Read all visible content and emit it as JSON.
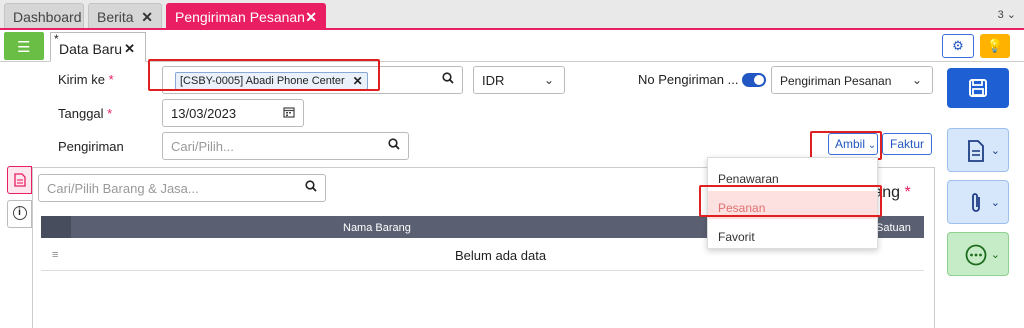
{
  "top_tabs": [
    {
      "label": "Dashboard"
    },
    {
      "label": "Berita"
    },
    {
      "label": "Pengiriman Pesanan"
    }
  ],
  "top_tab_count": "3",
  "doc_tab": {
    "label": "Data Baru",
    "star": "*"
  },
  "form": {
    "kirim_ke_label": "Kirim ke",
    "kirim_ke_chip": "[CSBY-0005] Abadi Phone Center",
    "currency": "IDR",
    "no_pengiriman_label": "No Pengiriman ...",
    "no_pengiriman_type": "Pengiriman Pesanan",
    "tanggal_label": "Tanggal",
    "tanggal_value": "13/03/2023",
    "pengiriman_label": "Pengiriman",
    "pengiriman_placeholder": "Cari/Pilih...",
    "required_mark": "*"
  },
  "buttons": {
    "ambil": "Ambil",
    "faktur": "Faktur"
  },
  "ambil_menu": [
    {
      "label": "Penawaran"
    },
    {
      "label": "Pesanan"
    },
    {
      "label": "Favorit"
    }
  ],
  "items_panel": {
    "search_placeholder": "Cari/Pilih Barang & Jasa...",
    "partial_heading": "rang",
    "col_name": "Nama Barang",
    "col_unit": "Satuan",
    "empty_text": "Belum ada data"
  },
  "colors": {
    "accent": "#e91e63",
    "primary": "#1f5fd4",
    "green": "#6abe45",
    "warning": "#ffb300"
  }
}
